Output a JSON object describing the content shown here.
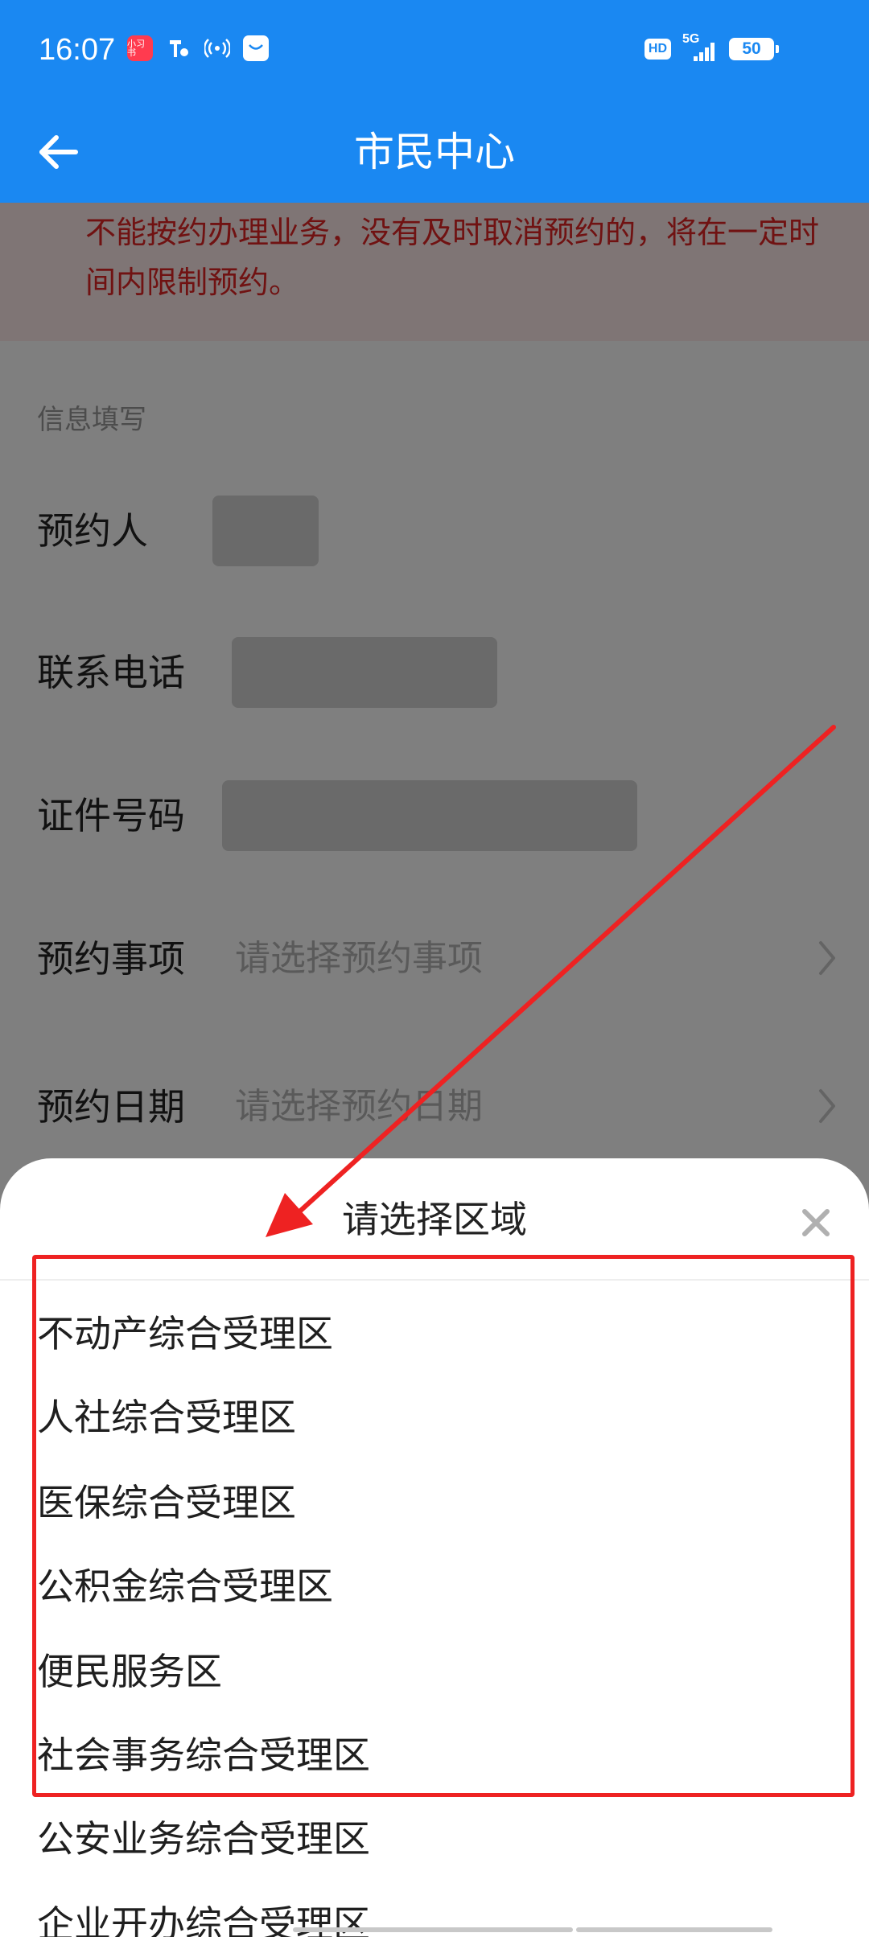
{
  "status_bar": {
    "time": "16:07",
    "red_app_label": "小习书",
    "network_badge": "HD",
    "network_type": "5G",
    "battery": "50"
  },
  "nav": {
    "title": "市民中心",
    "back_icon": "arrow-left-icon"
  },
  "notice": {
    "text": "不能按约办理业务，没有及时取消预约的，将在一定时间内限制预约。"
  },
  "form": {
    "section_title": "信息填写",
    "rows": [
      {
        "label": "预约人",
        "value": ""
      },
      {
        "label": "联系电话",
        "value": ""
      },
      {
        "label": "证件号码",
        "value": ""
      },
      {
        "label": "预约事项",
        "placeholder": "请选择预约事项"
      },
      {
        "label": "预约日期",
        "placeholder": "请选择预约日期"
      }
    ]
  },
  "sheet": {
    "title": "请选择区域",
    "close_icon": "close-icon",
    "options": [
      "不动产综合受理区",
      "人社综合受理区",
      "医保综合受理区",
      "公积金综合受理区",
      "便民服务区",
      "社会事务综合受理区",
      "公安业务综合受理区",
      "企业开办综合受理区"
    ]
  },
  "colors": {
    "primary": "#1a88f2",
    "notice_text": "#e02525",
    "annotation": "#ee2222"
  }
}
